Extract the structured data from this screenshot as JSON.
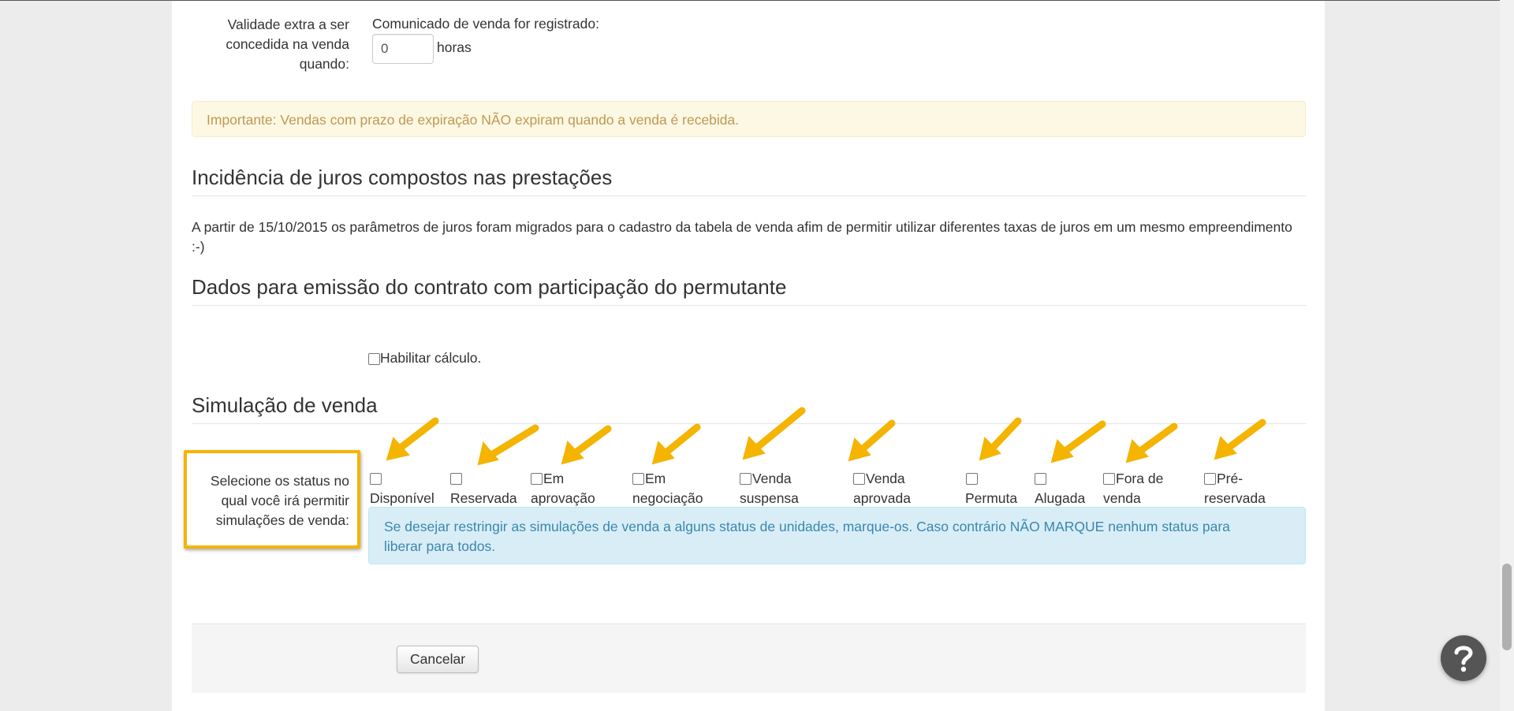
{
  "validity": {
    "label_line1": "Validade extra a ser",
    "label_line2": "concedida na venda",
    "label_line3": "quando:",
    "event_label": "Comunicado de venda for registrado:",
    "hours_value": "0",
    "hours_unit": "horas"
  },
  "warning": {
    "text": "Importante: Vendas com prazo de expiração NÃO expiram quando a venda é recebida."
  },
  "interest": {
    "title": "Incidência de juros compostos nas prestações",
    "text_line1": "A partir de 15/10/2015 os parâmetros de juros foram migrados para o cadastro da tabela de venda afim de permitir utilizar diferentes taxas de juros em um mesmo empreendimento",
    "text_line2": ":-)"
  },
  "contract": {
    "title": "Dados para emissão do contrato com participação do permutante",
    "enable_label": "Habilitar cálculo."
  },
  "simulation": {
    "title": "Simulação de venda",
    "label_line1": "Selecione os status no",
    "label_line2": "qual você irá permitir",
    "label_line3": "simulações de venda:",
    "statuses": [
      {
        "line1": "",
        "line2": "Disponível"
      },
      {
        "line1": "",
        "line2": "Reservada"
      },
      {
        "line1": "Em",
        "line2": "aprovação"
      },
      {
        "line1": "Em",
        "line2": "negociação"
      },
      {
        "line1": "Venda",
        "line2": "suspensa"
      },
      {
        "line1": "Venda",
        "line2": "aprovada"
      },
      {
        "line1": "",
        "line2": "Permuta"
      },
      {
        "line1": "",
        "line2": "Alugada"
      },
      {
        "line1": "Fora de",
        "line2": "venda"
      },
      {
        "line1": "Pré-",
        "line2": "reservada"
      }
    ],
    "info_line1": "Se desejar restringir as simulações de venda a alguns status de unidades, marque-os. Caso contrário NÃO MARQUE nenhum status para",
    "info_line2": "liberar para todos."
  },
  "actions": {
    "cancel_label": "Cancelar"
  },
  "colors": {
    "arrow": "#f4b400",
    "warning_text": "#c09853",
    "info_text": "#3a87ad"
  },
  "icons": {
    "help": "question-mark-icon",
    "annotation": "arrow-icon"
  }
}
